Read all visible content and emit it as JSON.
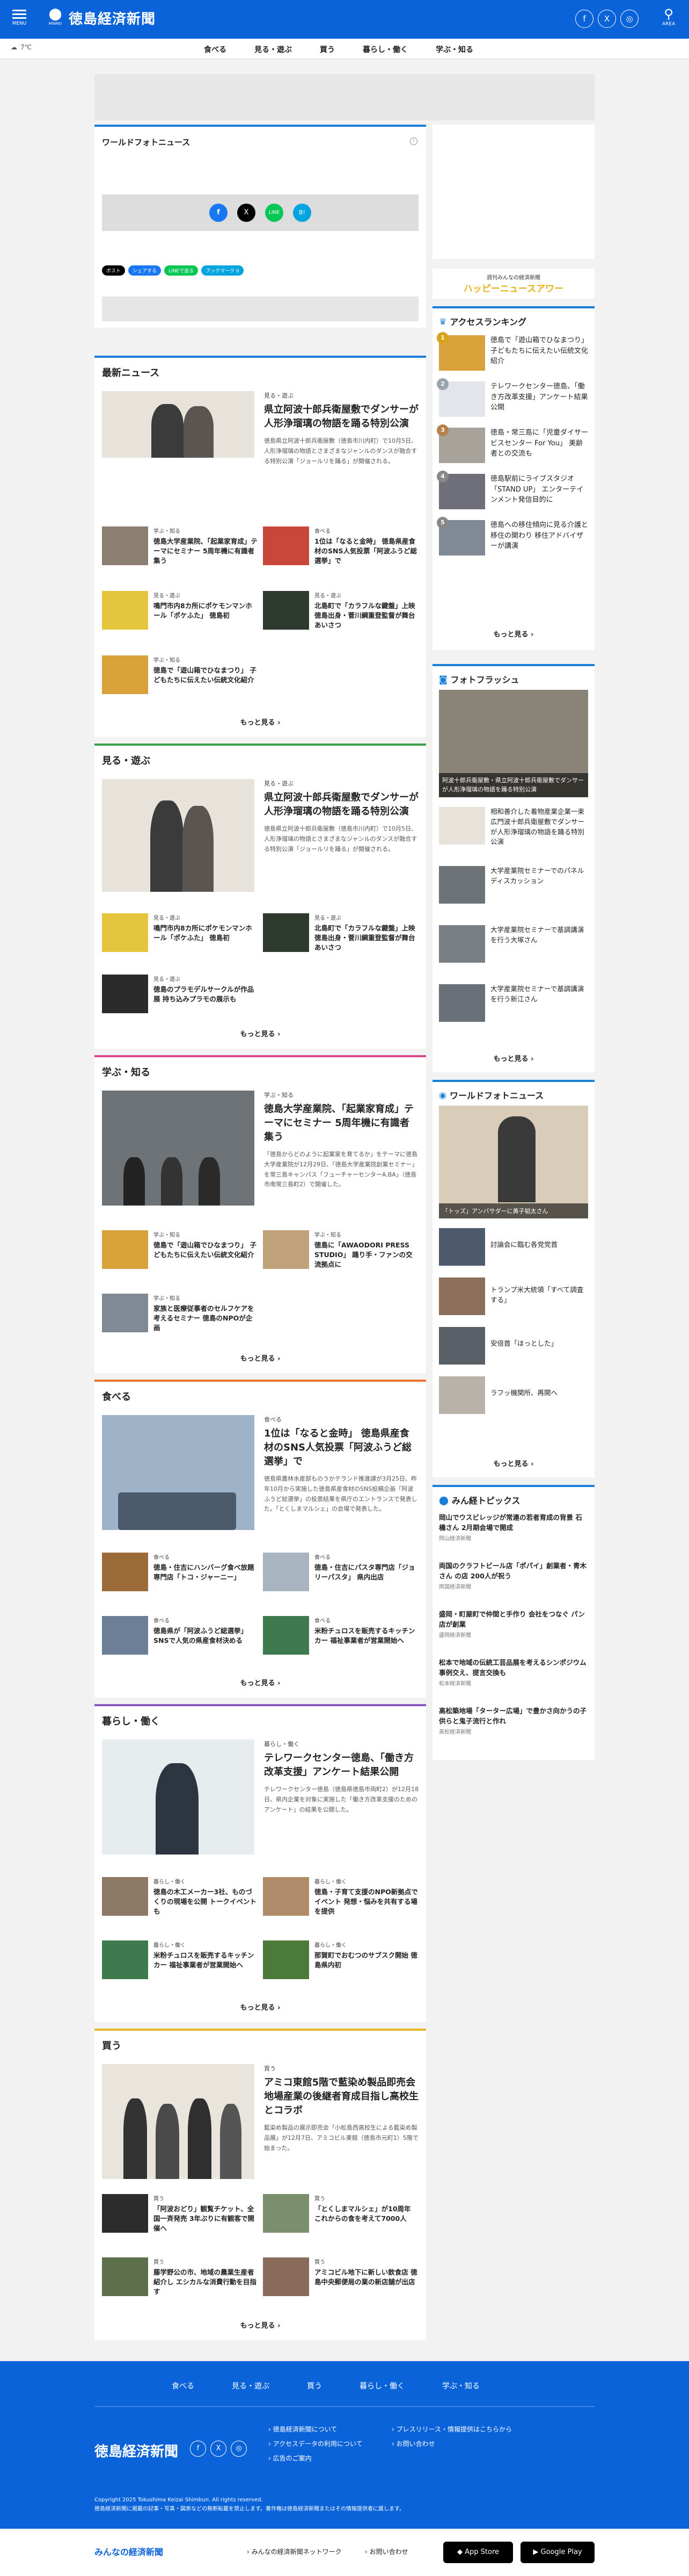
{
  "header": {
    "menu_label": "MENU",
    "site_name": "徳島経済新聞",
    "logo_sub": "MINKEI",
    "area_label": "AREA",
    "social": [
      "f",
      "X",
      "◎"
    ]
  },
  "weather": {
    "text": "7℃"
  },
  "nav": [
    "食べる",
    "見る・遊ぶ",
    "買う",
    "暮らし・働く",
    "学ぶ・知る"
  ],
  "world_photo": {
    "title": "ワールドフォトニュース",
    "share": [
      "f",
      "X",
      "LINE",
      "B!"
    ],
    "buttons": {
      "post": "ポスト",
      "share": "シェアする",
      "line": "LINEで送る",
      "hatena": "ブックマーク"
    },
    "hatena_count": "0"
  },
  "latest": {
    "title": "最新ニュース",
    "feature": {
      "cat": "見る・遊ぶ",
      "title": "県立阿波十郎兵衛屋敷でダンサーが人形浄瑠璃の物語を踊る特別公演",
      "desc": "徳島県立阿波十郎兵衛屋敷（徳島市川内町）で10月5日、人形浄瑠璃の物語とさまざまなジャンルのダンスが融合する特別公演「ジョールリを踊る」が開催される。"
    },
    "items": [
      {
        "cat": "学ぶ・知る",
        "title": "徳島大学産業院、「起業家育成」テーマにセミナー 5周年機に有識者集う"
      },
      {
        "cat": "食べる",
        "title": "1位は「なると金時」 徳島県産食材のSNS人気投票「阿波ふうど総選挙」で"
      },
      {
        "cat": "見る・遊ぶ",
        "title": "鳴門市内8カ所にポケモンマンホール「ポケふた」 徳島初"
      },
      {
        "cat": "見る・遊ぶ",
        "title": "北島町で「カラフルな鍵盤」上映 徳島出身・菅川綱重登監督が舞台あいさつ"
      },
      {
        "cat": "学ぶ・知る",
        "title": "徳島で「遊山箱でひなまつり」 子どもたちに伝えたい伝統文化紹介"
      }
    ],
    "more": "もっと見る"
  },
  "see": {
    "title": "見る・遊ぶ",
    "feature": {
      "cat": "見る・遊ぶ",
      "title": "県立阿波十郎兵衛屋敷でダンサーが人形浄瑠璃の物語を踊る特別公演",
      "desc": "徳島県立阿波十郎兵衛屋敷（徳島市川内町）で10月5日、人形浄瑠璃の物語とさまざまなジャンルのダンスが融合する特別公演「ジョールリを踊る」が開催される。"
    },
    "items": [
      {
        "cat": "見る・遊ぶ",
        "title": "鳴門市内8カ所にポケモンマンホール「ポケふた」 徳島初"
      },
      {
        "cat": "見る・遊ぶ",
        "title": "北島町で「カラフルな鍵盤」上映 徳島出身・菅川綱重登監督が舞台あいさつ"
      },
      {
        "cat": "見る・遊ぶ",
        "title": "徳島のプラモデルサークルが作品展 持ち込みプラモの展示も"
      }
    ],
    "more": "もっと見る"
  },
  "learn": {
    "title": "学ぶ・知る",
    "feature": {
      "cat": "学ぶ・知る",
      "title": "徳島大学産業院、「起業家育成」テーマにセミナー 5周年機に有識者集う",
      "desc": "「徳島からどのように起業家を育てるか」をテーマに徳島大学産業院が12月29日、「徳島大学産業院創業セミナー」を常三島キャンパス「フューチャーセンターA.BA」（徳島市南常三島町2）で開催した。"
    },
    "items": [
      {
        "cat": "学ぶ・知る",
        "title": "徳島で「遊山箱でひなまつり」 子どもたちに伝えたい伝統文化紹介"
      },
      {
        "cat": "学ぶ・知る",
        "title": "徳島に「AWAODORI PRESS STUDIO」 踊り手・ファンの交流拠点に"
      },
      {
        "cat": "学ぶ・知る",
        "title": "家族と医療従事者のセルフケアを考えるセミナー 徳島のNPOが企画"
      }
    ],
    "more": "もっと見る"
  },
  "eat": {
    "title": "食べる",
    "feature": {
      "cat": "食べる",
      "title": "1位は「なると金時」 徳島県産食材のSNS人気投票「阿波ふうど総選挙」で",
      "desc": "徳島県農林水産部ものうかテランド推進課が3月25日、昨年10月から実施した徳島県産食材のSNS投稿企画「阿波ふうど総選挙」の投票結果を県庁のエントランスで発表した。「とくしまマルシェ」の会場で発表した。"
    },
    "items": [
      {
        "cat": "食べる",
        "title": "徳島・住吉にハンバーグ食べ放題専門店「トコ・ジャーニー」"
      },
      {
        "cat": "食べる",
        "title": "徳島・住吉にパスタ専門店「ジョリーパスタ」 県内出店"
      },
      {
        "cat": "食べる",
        "title": "徳島県が「阿波ふうど総選挙」 SNSで人気の県産食材決める"
      },
      {
        "cat": "食べる",
        "title": "米粉チュロスを販売するキッチンカー 福祉事業者が営業開始へ"
      }
    ],
    "more": "もっと見る"
  },
  "live": {
    "title": "暮らし・働く",
    "feature": {
      "cat": "暮らし・働く",
      "title": "テレワークセンター徳島、「働き方改革支援」アンケート結果公開",
      "desc": "テレワークセンター徳島（徳島県徳島市両町2）が12月18日、県内企業を対象に実施した「働き方改革支援のためのアンケート」の結果を公開した。"
    },
    "items": [
      {
        "cat": "暮らし・働く",
        "title": "徳島の木工メーカー3社、ものづくりの現場を公開 トークイベントも"
      },
      {
        "cat": "暮らし・働く",
        "title": "徳島・子育て支援のNPO新拠点でイベント 発想・悩みを共有する場を提供"
      },
      {
        "cat": "暮らし・働く",
        "title": "米粉チュロスを販売するキッチンカー 福祉事業者が営業開始へ"
      },
      {
        "cat": "暮らし・働く",
        "title": "那賀町でおむつのサブスク開始 徳島県内初"
      }
    ],
    "more": "もっと見る"
  },
  "buy": {
    "title": "買う",
    "feature": {
      "cat": "買う",
      "title": "アミコ東館5階で藍染め製品即売会 地場産業の後継者育成目指し高校生とコラボ",
      "desc": "藍染め製品の展示即売会「小松島西高校生による藍染め製品展」が12月7日、アミコビル東館（徳島市元町1）5階で始まった。"
    },
    "items": [
      {
        "cat": "買う",
        "title": "「阿波おどり」観覧チケット、全国一斉発売 3年ぶりに有観客で開催へ"
      },
      {
        "cat": "買う",
        "title": "「とくしまマルシェ」が10周年 これからの食を考えて7000人"
      },
      {
        "cat": "買う",
        "title": "藤学野公の市、地域の農業生産者紹介し エシカルな消費行動を目指す"
      },
      {
        "cat": "買う",
        "title": "アミコビル地下に新しい飲食店 徳島中央郵便局の業の新店舗が出店"
      }
    ],
    "more": "もっと見る"
  },
  "sidebar": {
    "banner_top": "週刊みんなの経済新聞",
    "banner_main": "ハッピーニュースアワー",
    "ranking": {
      "title": "アクセスランキング",
      "items": [
        "徳島で「遊山箱でひなまつり」 子どもたちに伝えたい伝統文化紹介",
        "テレワークセンター徳島、「働き方改革支援」アンケート結果公開",
        "徳島・常三島に「児童ダイサービスセンター For You」 美齢者との交流も",
        "徳島駅前にライブスタジオ「STAND UP」 エンターテインメント発信目的に",
        "徳島への移住傾向に見る介護と移住の関わり 移住アドバイザーが講演"
      ],
      "more": "もっと見る"
    },
    "flash": {
      "title": "フォトフラッシュ",
      "caption": "阿波十郎兵衛屋敷・県立阿波十郎兵衛屋敷でダンサーが人形浄瑠璃の物語を踊る特別公演",
      "items": [
        "相和善介した着物産業企業一束広門波十郎兵衛屋敷でダンサーが人形浄瑠璃の物語を踊る特別公演",
        "大学産業院セミナーでのパネルディスカッション",
        "大学産業院セミナーで基調講演を行う大塚さん",
        "大学産業院セミナーで基調講演を行う新江さん"
      ],
      "more": "もっと見る"
    },
    "world": {
      "title": "ワールドフォトニュース",
      "caption": "「トッズ」アンバサダーに黄子韬太さん",
      "items": [
        "討論会に臨む各党党首",
        "トランプ米大統領「すべて調査する」",
        "安倍首「ほっとした」",
        "ラフッ機関所、再開へ"
      ],
      "more": "もっと見る"
    },
    "topics": {
      "title": "みん経トピックス",
      "items": [
        {
          "t": "岡山でウスビレッジが常連の若者育成の背景 石橋さん 2月期会場で開成",
          "s": "岡山経済新聞"
        },
        {
          "t": "両国のクラフトビール店「ポパイ」創業者・青木さん の店 200人が祝う",
          "s": "両国経済新聞"
        },
        {
          "t": "盛岡・町屋町で仲間と手作り 会社をつなぐ パン店が創業",
          "s": "盛岡経済新聞"
        },
        {
          "t": "松本で地域の伝統工芸品展を考えるシンポジウム 事例交え、提言交換も",
          "s": "松本経済新聞"
        },
        {
          "t": "高松築地場「ターター広場」で豊かさ向かうの子供らと鬼子流行と作れ",
          "s": "高松経済新聞"
        }
      ]
    }
  },
  "footer": {
    "nav": [
      "食べる",
      "見る・遊ぶ",
      "買う",
      "暮らし・働く",
      "学ぶ・知る"
    ],
    "logo": "徳島経済新聞",
    "links": [
      "徳島経済新聞について",
      "プレスリリース・情報提供はこちらから",
      "アクセスデータの利用について",
      "お問い合わせ",
      "広告のご案内"
    ],
    "copyright": "Copyright 2025 Tokushima Keizai Shimbun. All rights reserved.",
    "note": "徳島経済新聞に掲載の記事・写真・図表などの無断転載を禁止します。著作権は徳島経済新聞またはその情報提供者に属します。"
  },
  "bottom": {
    "network": "みんなの経済新聞ネットワーク",
    "contact": "お問い合わせ",
    "appstore": "App Store",
    "googleplay": "Google Play"
  }
}
